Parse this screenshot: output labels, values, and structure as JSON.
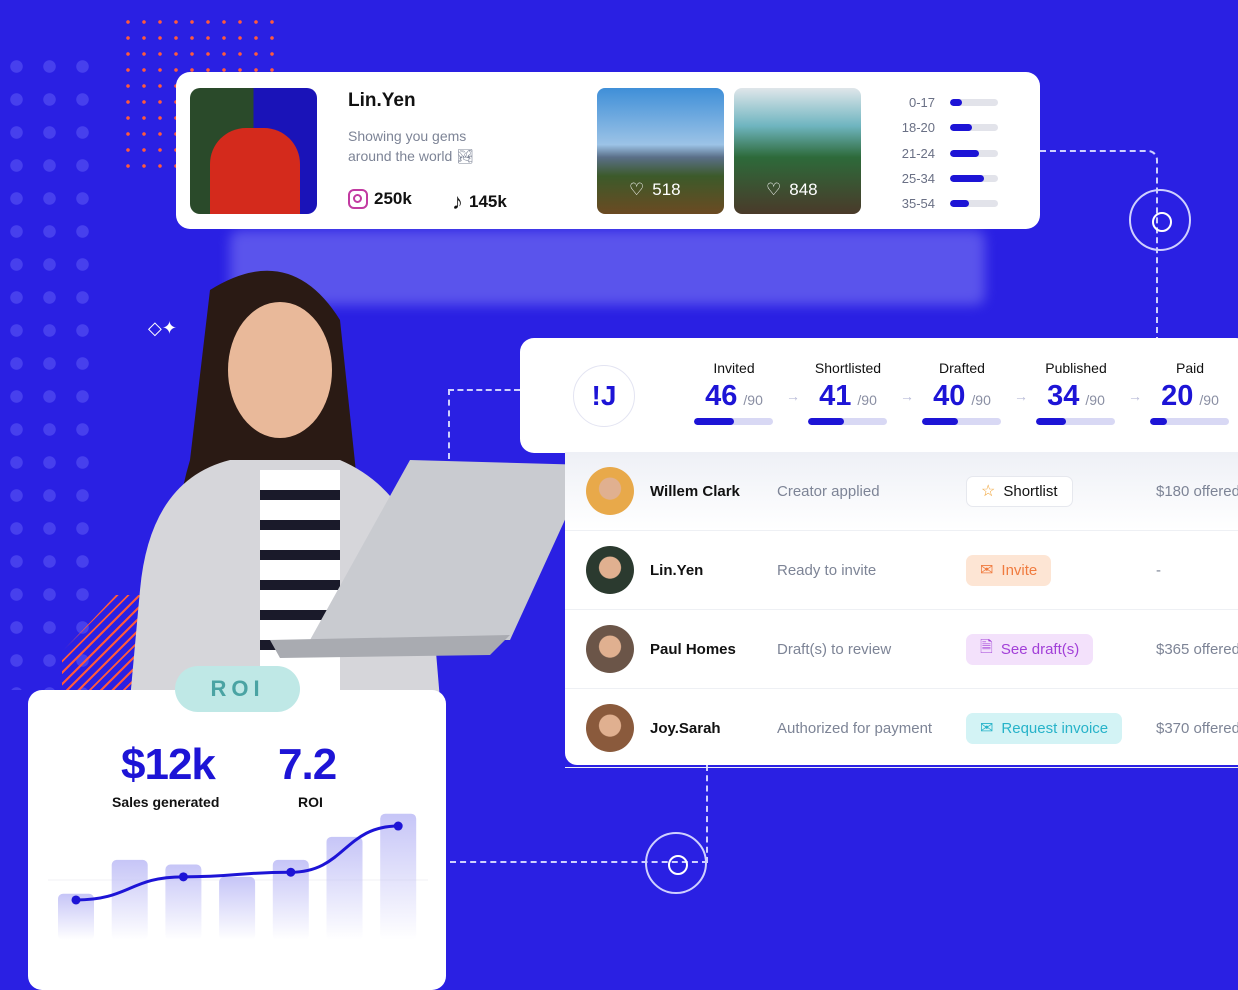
{
  "profile": {
    "name": "Lin.Yen",
    "bio": "Showing you gems around the world 🏞",
    "instagram": "250k",
    "tiktok": "145k",
    "posts": [
      {
        "likes": "518"
      },
      {
        "likes": "848"
      }
    ],
    "age_groups": [
      {
        "label": "0-17",
        "share": 0.25
      },
      {
        "label": "18-20",
        "share": 0.45
      },
      {
        "label": "21-24",
        "share": 0.6
      },
      {
        "label": "25-34",
        "share": 0.7
      },
      {
        "label": "35-54",
        "share": 0.4
      }
    ]
  },
  "pipeline": {
    "logo": "!J",
    "total": "/90",
    "stages": [
      {
        "label": "Invited",
        "value": "46",
        "fraction": 0.51
      },
      {
        "label": "Shortlisted",
        "value": "41",
        "fraction": 0.45
      },
      {
        "label": "Drafted",
        "value": "40",
        "fraction": 0.45
      },
      {
        "label": "Published",
        "value": "34",
        "fraction": 0.38
      },
      {
        "label": "Paid",
        "value": "20",
        "fraction": 0.22
      }
    ]
  },
  "creators": [
    {
      "name": "Willem Clark",
      "status": "Creator applied",
      "action": "Shortlist",
      "icon": "star-icon",
      "offer": "$180 offered",
      "bg": "#ffffff",
      "fg": "#111111",
      "avatar": "#e8a94a"
    },
    {
      "name": "Lin.Yen",
      "status": "Ready to invite",
      "action": "Invite",
      "icon": "mail-icon",
      "offer": "-",
      "bg": "#fde5d4",
      "fg": "#f07b3f",
      "avatar": "#2b3a2f"
    },
    {
      "name": "Paul Homes",
      "status": "Draft(s) to review",
      "action": "See draft(s)",
      "icon": "document-icon",
      "offer": "$365 offered",
      "bg": "#f3e1fb",
      "fg": "#a23fd8",
      "avatar": "#6b5548"
    },
    {
      "name": "Joy.Sarah",
      "status": "Authorized for payment",
      "action": "Request invoice",
      "icon": "mail-icon",
      "offer": "$370 offered",
      "bg": "#d3f3f5",
      "fg": "#27b3c9",
      "avatar": "#8a5a3c"
    }
  ],
  "roi": {
    "pill": "ROI",
    "sales_value": "$12k",
    "sales_label": "Sales generated",
    "roi_value": "7.2",
    "roi_label": "ROI"
  },
  "chart_data": {
    "type": "bar",
    "bars": [
      3,
      5.2,
      4.9,
      4.1,
      5.2,
      6.7,
      8.2
    ],
    "line": [
      [
        0,
        2.6
      ],
      [
        2,
        4.1
      ],
      [
        4,
        4.4
      ],
      [
        6,
        7.4
      ]
    ],
    "colors": {
      "bar": "#c9c8f7",
      "line": "#1d14d6"
    }
  }
}
